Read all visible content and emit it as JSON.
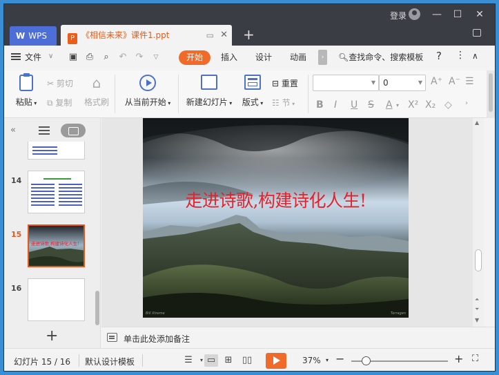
{
  "titlebar": {
    "login_label": "登录",
    "app_tab": "WPS",
    "doc_tab": "《相信未来》课件1.ppt"
  },
  "menubar": {
    "file": "文件",
    "tabs": [
      "开始",
      "插入",
      "设计",
      "动画"
    ],
    "search": "查找命令、搜索模板",
    "help": "?"
  },
  "ribbon": {
    "paste": "粘贴",
    "cut": "剪切",
    "copy": "复制",
    "format_painter": "格式刷",
    "play_from_current": "从当前开始",
    "new_slide": "新建幻灯片",
    "layout": "版式",
    "reset": "重置",
    "section": "节",
    "font_name": "",
    "font_size": "0"
  },
  "slides_panel": {
    "numbers": [
      "14",
      "15",
      "16"
    ],
    "active": "15",
    "thumb15_title": "走进诗歌,构建诗化人生!"
  },
  "slide": {
    "title": "走进诗歌,构建诗化人生!",
    "footer_left": "Bill Xtreme",
    "footer_right": "Terragen"
  },
  "notes": {
    "placeholder": "单击此处添加备注"
  },
  "status": {
    "slide_counter": "幻灯片 15 / 16",
    "template": "默认设计模板",
    "zoom": "37%"
  },
  "colors": {
    "accent": "#f06b2a",
    "wps_tab": "#4c6ed6",
    "title_red": "#e8202a"
  }
}
